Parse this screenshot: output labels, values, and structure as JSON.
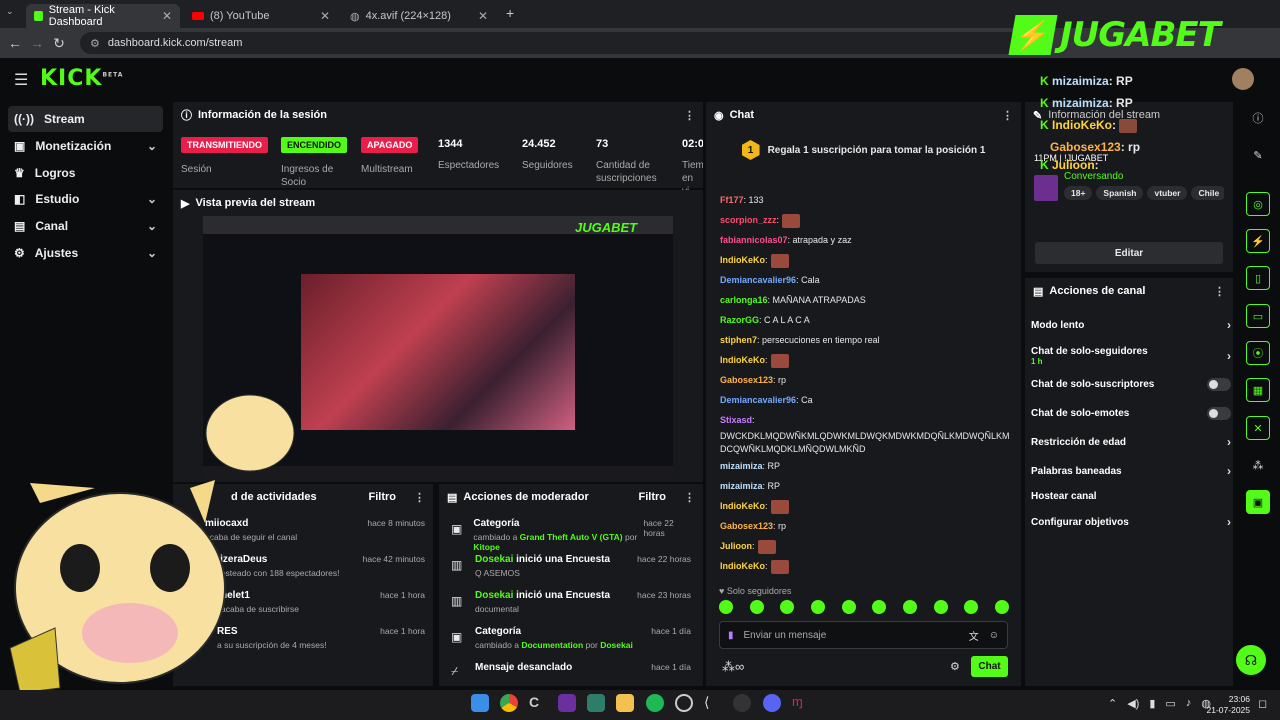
{
  "browser": {
    "tabs": [
      {
        "label": "Stream - Kick Dashboard",
        "active": true
      },
      {
        "label": "(8) YouTube",
        "active": false
      },
      {
        "label": "4x.avif (224×128)",
        "active": false
      }
    ],
    "url": "dashboard.kick.com/stream"
  },
  "app": {
    "logo": "KICK",
    "logo_sup": "BETA"
  },
  "sidebar": {
    "items": [
      {
        "label": "Stream",
        "icon": "stream-icon"
      },
      {
        "label": "Monetización",
        "icon": "money-icon"
      },
      {
        "label": "Logros",
        "icon": "trophy-icon"
      },
      {
        "label": "Estudio",
        "icon": "studio-icon"
      },
      {
        "label": "Canal",
        "icon": "channel-icon"
      },
      {
        "label": "Ajustes",
        "icon": "gear-icon"
      }
    ]
  },
  "session": {
    "title": "Información de la sesión",
    "stats": [
      {
        "badge": "TRANSMITIENDO",
        "label": "Sesión"
      },
      {
        "badge": "ENCENDIDO",
        "label": "Ingresos de Socio"
      },
      {
        "badge": "APAGADO",
        "label": "Multistream"
      },
      {
        "value": "1344",
        "label": "Espectadores"
      },
      {
        "value": "24.452",
        "label": "Seguidores"
      },
      {
        "value": "73",
        "label": "Cantidad de suscripciones"
      },
      {
        "value": "02:0",
        "label": "Tiem en vi"
      }
    ]
  },
  "preview": {
    "title": "Vista previa del stream"
  },
  "activity": {
    "title": "d de actividades",
    "filter": "Filtro",
    "items": [
      {
        "user": "miiocaxd",
        "desc": "acaba de seguir el canal",
        "time": "hace 8 minutos"
      },
      {
        "user": "akizeraDeus",
        "desc": "o hosteado con 188 espectadores!",
        "time": "hace 42 minutos"
      },
      {
        "user": "helet1",
        "desc": "acaba de suscribirse",
        "time": "hace 1 hora"
      },
      {
        "user": "RES",
        "desc": "a su suscripción de 4 meses!",
        "time": "hace 1 hora"
      }
    ]
  },
  "mod": {
    "title": "Acciones de moderador",
    "filter": "Filtro",
    "items": [
      {
        "title": "Categoría",
        "desc_pre": "cambiado a ",
        "desc_hl": "Grand Theft Auto V (GTA)",
        "desc_post": " por ",
        "desc_by": "Kitope",
        "time": "hace 22 horas"
      },
      {
        "title_hl": "Dosekai",
        "title": " inició una Encuesta",
        "desc": "Q ASEMOS",
        "time": "hace 22 horas"
      },
      {
        "title_hl": "Dosekai",
        "title": " inició una Encuesta",
        "desc": "documental",
        "time": "hace 23 horas"
      },
      {
        "title": "Categoría",
        "desc_pre": "cambiado a ",
        "desc_hl": "Documentation",
        "desc_post": " por ",
        "desc_by": "Dosekai",
        "time": "hace 1 día"
      },
      {
        "title": "Mensaje desanclado",
        "desc": "",
        "time": "hace 1 día"
      }
    ]
  },
  "chat": {
    "title": "Chat",
    "gift_number": "1",
    "gift_text": "Regala 1 suscripción para tomar la posición 1",
    "lines": [
      {
        "user": "Ff177",
        "color": "#ff6b6b",
        "text": ": 133"
      },
      {
        "user": "scorpion_zzz",
        "color": "#ff4d6d",
        "text": ":",
        "emote": true
      },
      {
        "user": "fabiannicolas07",
        "color": "#ff4d8d",
        "text": ": atrapada y zaz"
      },
      {
        "user": "IndioKeKo",
        "color": "#ffd43b",
        "text": ":",
        "emote": true
      },
      {
        "user": "Demiancavalier96",
        "color": "#74a9ff",
        "text": ": Cala"
      },
      {
        "user": "carlonga16",
        "color": "#53fc18",
        "text": ": MAÑANA ATRAPADAS"
      },
      {
        "user": "RazorGG",
        "color": "#53fc18",
        "text": ": C A L A C A"
      },
      {
        "user": "stiphen7",
        "color": "#ffd43b",
        "text": ": persecuciones en tiempo real"
      },
      {
        "user": "IndioKeKo",
        "color": "#ffd43b",
        "text": ":",
        "emote": true
      },
      {
        "user": "Gabosex123",
        "color": "#ffb347",
        "text": ": rp"
      },
      {
        "user": "Demiancavalier96",
        "color": "#74a9ff",
        "text": ": Ca"
      },
      {
        "user": "Stixasd",
        "color": "#c77dff",
        "text": ":"
      },
      {
        "user": "",
        "color": "#e8e8e8",
        "text": "DWCKDKLMQDWÑKMLQDWKMLDWQKMDWKMDQÑLKMDWQÑLKM"
      },
      {
        "user": "",
        "color": "#e8e8e8",
        "text": "DCQWÑKLMQDKLMÑQDWLMKÑD"
      },
      {
        "user": "mizaimiza",
        "color": "#bde0fe",
        "text": ": RP"
      },
      {
        "user": "mizaimiza",
        "color": "#bde0fe",
        "text": ": RP"
      },
      {
        "user": "IndioKeKo",
        "color": "#ffd43b",
        "text": ":",
        "emote": true
      },
      {
        "user": "Gabosex123",
        "color": "#ffb347",
        "text": ": rp"
      },
      {
        "user": "Julioon",
        "color": "#ffd43b",
        "text": ":",
        "emote": true
      },
      {
        "user": "IndioKeKo",
        "color": "#ffd43b",
        "text": ":",
        "emote": true
      }
    ],
    "followers_only": "Solo seguidores",
    "input_placeholder": "Enviar un mensaje",
    "send_label": "Chat"
  },
  "overlay": {
    "brand": "JUGABET",
    "lines": [
      {
        "user": "mizaimiza",
        "text": ": RP"
      },
      {
        "user": "mizaimiza",
        "text": ": RP"
      },
      {
        "user": "IndioKeKo",
        "text": ":"
      },
      {
        "user": "Gabosex123",
        "text": ": rp"
      },
      {
        "user": "Julioon",
        "text": ":"
      }
    ]
  },
  "channel_info": {
    "title": "Información del stream",
    "stream_title": "11PM | !JUGABET",
    "category": "Conversando",
    "tags": [
      "18+",
      "Spanish",
      "vtuber",
      "Chile"
    ],
    "edit_label": "Editar"
  },
  "channel_actions": {
    "title": "Acciones de canal",
    "items": [
      {
        "label": "Modo lento",
        "type": "chevron"
      },
      {
        "label": "Chat de solo-seguidores",
        "sub": "1 h",
        "type": "chevron"
      },
      {
        "label": "Chat de solo-suscriptores",
        "type": "toggle"
      },
      {
        "label": "Chat de solo-emotes",
        "type": "toggle"
      },
      {
        "label": "Restricción de edad",
        "type": "chevron"
      },
      {
        "label": "Palabras baneadas",
        "type": "chevron"
      },
      {
        "label": "Hostear canal",
        "type": "none"
      },
      {
        "label": "Configurar objetivos",
        "type": "chevron"
      }
    ]
  },
  "taskbar": {
    "time": "23:06",
    "date": "21-07-2025"
  },
  "colors": {
    "accent": "#53fc18",
    "live": "#e91e4a",
    "panel": "#18191c"
  }
}
